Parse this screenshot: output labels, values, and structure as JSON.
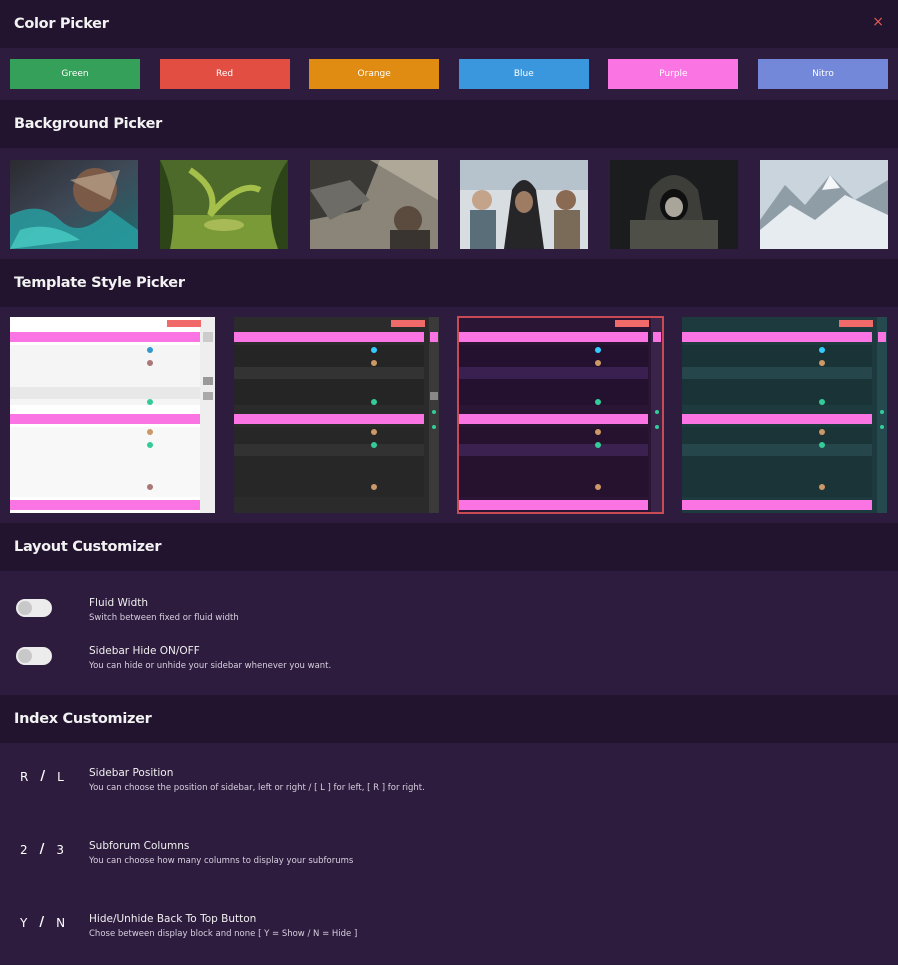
{
  "color_picker": {
    "title": "Color Picker",
    "close": "×",
    "colors": [
      {
        "label": "Green",
        "color": "#35a05a"
      },
      {
        "label": "Red",
        "color": "#e24e42"
      },
      {
        "label": "Orange",
        "color": "#e08b12"
      },
      {
        "label": "Blue",
        "color": "#3b97dd"
      },
      {
        "label": "Purple",
        "color": "#fb74e3"
      },
      {
        "label": "Nitro",
        "color": "#7388d9"
      }
    ]
  },
  "background_picker": {
    "title": "Background Picker",
    "items": [
      "fantasy-battle",
      "jungle-scene",
      "soldier-mech",
      "assassins-group",
      "hooded-soldier",
      "snowy-mountains"
    ]
  },
  "template_picker": {
    "title": "Template Style Picker",
    "templates": [
      "light",
      "dark",
      "purple",
      "teal"
    ],
    "selected": "purple"
  },
  "layout_customizer": {
    "title": "Layout Customizer",
    "options": [
      {
        "title": "Fluid Width",
        "desc": "Switch between fixed or fluid width"
      },
      {
        "title": "Sidebar Hide ON/OFF",
        "desc": "You can hide or unhide your sidebar whenever you want."
      }
    ]
  },
  "index_customizer": {
    "title": "Index Customizer",
    "options": [
      {
        "key_a": "R",
        "key_b": "L",
        "title": "Sidebar Position",
        "desc": "You can choose the position of sidebar, left or right / [ L ] for left, [ R ] for right."
      },
      {
        "key_a": "2",
        "key_b": "3",
        "title": "Subforum Columns",
        "desc": "You can choose how many columns to display your subforums"
      },
      {
        "key_a": "Y",
        "key_b": "N",
        "title": "Hide/Unhide Back To Top Button",
        "desc": "Chose between display block and none [ Y = Show / N = Hide ]"
      }
    ],
    "separator": "/"
  }
}
